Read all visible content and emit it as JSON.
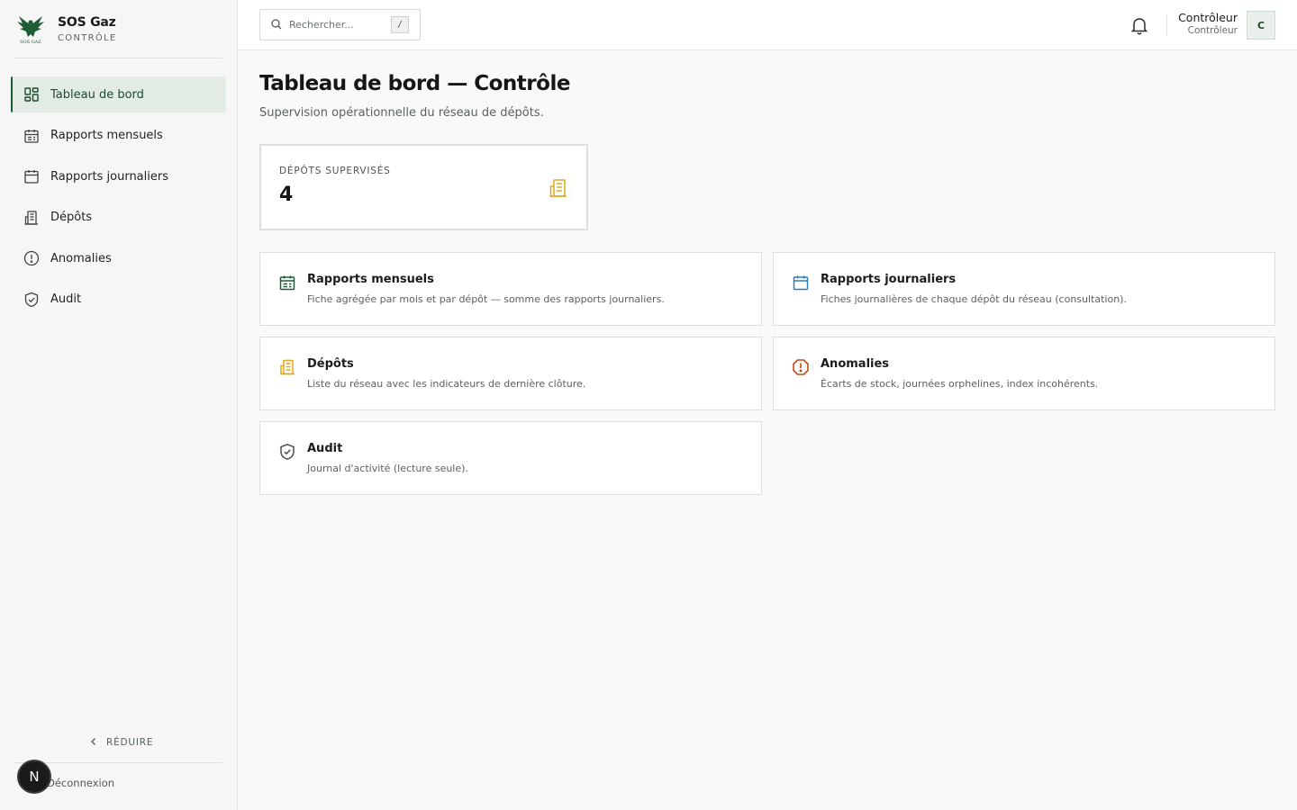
{
  "brand": {
    "name": "SOS Gaz",
    "subtitle": "CONTRÔLE"
  },
  "sidebar": {
    "items": [
      {
        "label": "Tableau de bord",
        "icon": "dashboard-icon",
        "active": true
      },
      {
        "label": "Rapports mensuels",
        "icon": "calendar-month-icon",
        "active": false
      },
      {
        "label": "Rapports journaliers",
        "icon": "calendar-icon",
        "active": false
      },
      {
        "label": "Dépôts",
        "icon": "building-icon",
        "active": false
      },
      {
        "label": "Anomalies",
        "icon": "alert-circle-icon",
        "active": false
      },
      {
        "label": "Audit",
        "icon": "shield-check-icon",
        "active": false
      }
    ],
    "collapse_label": "RÉDUIRE",
    "logout_label": "Déconnexion",
    "badge_letter": "N"
  },
  "header": {
    "search_placeholder": "Rechercher...",
    "search_shortcut": "/",
    "user_name": "Contrôleur",
    "user_role": "Contrôleur",
    "avatar_letter": "C"
  },
  "main": {
    "title": "Tableau de bord — Contrôle",
    "subtitle": "Supervision opérationnelle du réseau de dépôts.",
    "kpi": {
      "label": "DÉPÔTS SUPERVISÉS",
      "value": "4",
      "icon": "building-icon"
    },
    "cards": [
      {
        "title": "Rapports mensuels",
        "desc": "Fiche agrégée par mois et par dépôt — somme des rapports journaliers.",
        "icon": "calendar-month-icon",
        "color": "#1d5c36"
      },
      {
        "title": "Rapports journaliers",
        "desc": "Fiches journalières de chaque dépôt du réseau (consultation).",
        "icon": "calendar-icon",
        "color": "#2f7bc4"
      },
      {
        "title": "Dépôts",
        "desc": "Liste du réseau avec les indicateurs de dernière clôture.",
        "icon": "building-icon",
        "color": "#e0a81e"
      },
      {
        "title": "Anomalies",
        "desc": "Écarts de stock, journées orphelines, index incohérents.",
        "icon": "alert-octagon-icon",
        "color": "#c24a12"
      },
      {
        "title": "Audit",
        "desc": "Journal d'activité (lecture seule).",
        "icon": "shield-check-icon",
        "color": "#4a504a"
      }
    ]
  },
  "colors": {
    "accent": "#1d5c36",
    "active_bg": "#e2ebe4",
    "kpi_icon": "#e0a81e"
  }
}
